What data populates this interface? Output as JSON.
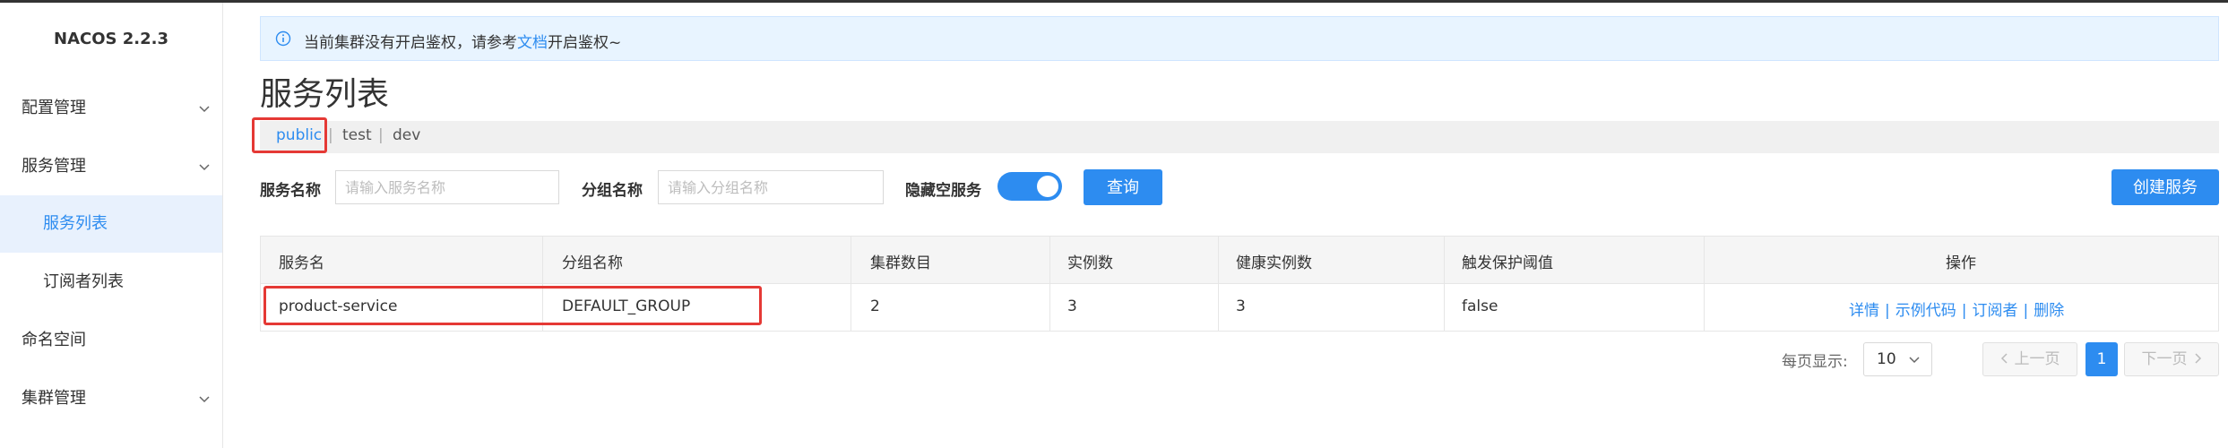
{
  "app": {
    "brand": "NACOS 2.2.3"
  },
  "sidebar": {
    "items": [
      {
        "label": "配置管理"
      },
      {
        "label": "服务管理"
      },
      {
        "label": "服务列表"
      },
      {
        "label": "订阅者列表"
      },
      {
        "label": "命名空间"
      },
      {
        "label": "集群管理"
      }
    ]
  },
  "notice": {
    "prefix": "当前集群没有开启鉴权，请参考",
    "link": "文档",
    "suffix": "开启鉴权~"
  },
  "page": {
    "title": "服务列表"
  },
  "namespaces": [
    "public",
    "test",
    "dev"
  ],
  "filters": {
    "service_name_label": "服务名称",
    "service_name_placeholder": "请输入服务名称",
    "group_name_label": "分组名称",
    "group_name_placeholder": "请输入分组名称",
    "hide_empty_label": "隐藏空服务",
    "hide_empty_on": true,
    "query_button": "查询",
    "create_button": "创建服务"
  },
  "table": {
    "headers": [
      "服务名",
      "分组名称",
      "集群数目",
      "实例数",
      "健康实例数",
      "触发保护阈值",
      "操作"
    ],
    "rows": [
      {
        "service": "product-service",
        "group": "DEFAULT_GROUP",
        "clusters": "2",
        "instances": "3",
        "healthy": "3",
        "threshold": "false",
        "ops": [
          "详情",
          "示例代码",
          "订阅者",
          "删除"
        ]
      }
    ]
  },
  "pagination": {
    "label": "每页显示:",
    "page_size": "10",
    "prev": "上一页",
    "next": "下一页",
    "current": "1"
  },
  "colors": {
    "accent": "#2d8cf0",
    "highlight": "#e53935"
  }
}
